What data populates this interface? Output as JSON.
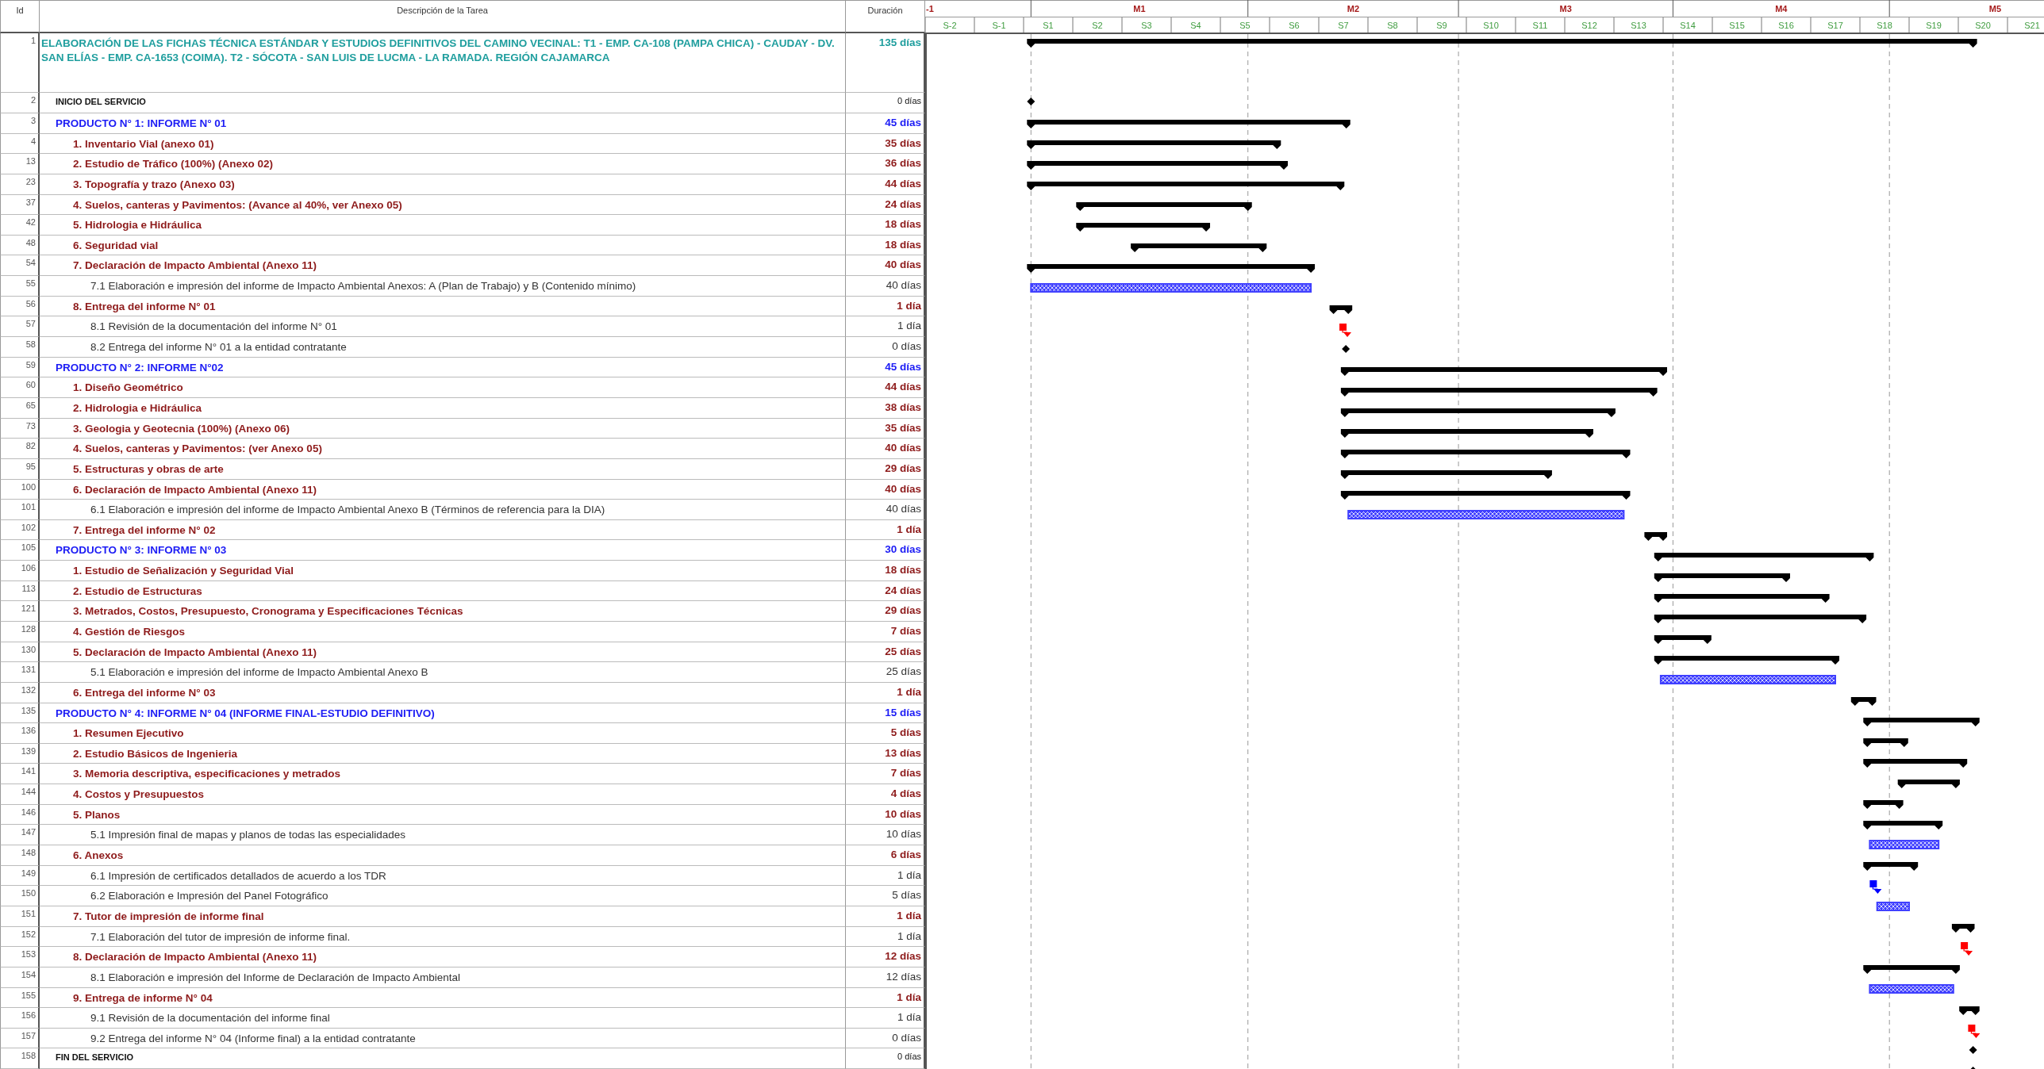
{
  "table": {
    "columns": [
      "Id",
      "Descripción de la Tarea",
      "Duración"
    ],
    "rows": [
      {
        "id": "1",
        "kind": "project",
        "name": "ELABORACIÓN DE LAS FICHAS TÉCNICA ESTÁNDAR Y ESTUDIOS DEFINITIVOS DEL CAMINO VECINAL: T1 - EMP. CA-108 (PAMPA CHICA) - CAUDAY - DV. SAN ELÍAS - EMP. CA-1653 (COIMA). T2 - SÓCOTA - SAN LUIS DE LUCMA - LA RAMADA. REGIÓN CAJAMARCA",
        "duration": "135 días",
        "children": [
          {
            "id": "2",
            "kind": "event",
            "name": "INICIO DEL SERVICIO",
            "duration": "0 días"
          },
          {
            "id": "3",
            "kind": "product",
            "name": "PRODUCTO N° 1: INFORME N° 01",
            "duration": "45 días",
            "children": [
              {
                "id": "4",
                "kind": "task",
                "name": "1. Inventario Vial (anexo 01)",
                "duration": "35 días"
              },
              {
                "id": "13",
                "kind": "task",
                "name": "2. Estudio de Tráfico (100%) (Anexo 02)",
                "duration": "36 días"
              },
              {
                "id": "23",
                "kind": "task",
                "name": "3. Topografía y trazo (Anexo 03)",
                "duration": "44 días"
              },
              {
                "id": "37",
                "kind": "task",
                "name": "4. Suelos, canteras y Pavimentos: (Avance al 40%, ver Anexo 05)",
                "duration": "24 días"
              },
              {
                "id": "42",
                "kind": "task",
                "name": "5. Hidrologia e Hidráulica",
                "duration": "18 días"
              },
              {
                "id": "48",
                "kind": "task",
                "name": "6. Seguridad vial",
                "duration": "18 días"
              },
              {
                "id": "54",
                "kind": "task",
                "name": "7. Declaración de Impacto Ambiental (Anexo 11)",
                "duration": "40 días",
                "children": [
                  {
                    "id": "55",
                    "kind": "subtask",
                    "name": "7.1 Elaboración e impresión del informe de Impacto Ambiental Anexos: A (Plan de Trabajo)  y B (Contenido mínimo)",
                    "duration": "40 días",
                    "color": "#4040ff"
                  }
                ]
              },
              {
                "id": "56",
                "kind": "task",
                "name": "8. Entrega del informe N° 01",
                "duration": "1 día",
                "children": [
                  {
                    "id": "57",
                    "kind": "subtask",
                    "name": "8.1 Revisión de la documentación del informe N° 01",
                    "duration": "1 día",
                    "color": "#ff0000"
                  },
                  {
                    "id": "58",
                    "kind": "milestone",
                    "name": "8.2 Entrega del informe N° 01 a la entidad contratante",
                    "duration": "0 días"
                  }
                ]
              }
            ]
          },
          {
            "id": "59",
            "kind": "product",
            "name": "PRODUCTO N° 2: INFORME N°02",
            "duration": "45 días",
            "children": [
              {
                "id": "60",
                "kind": "task",
                "name": "1. Diseño Geométrico",
                "duration": "44 días"
              },
              {
                "id": "65",
                "kind": "task",
                "name": "2. Hidrologia e Hidráulica",
                "duration": "38 días"
              },
              {
                "id": "73",
                "kind": "task",
                "name": "3. Geologia y Geotecnia (100%) (Anexo 06)",
                "duration": "35 días"
              },
              {
                "id": "82",
                "kind": "task",
                "name": "4. Suelos, canteras y Pavimentos: (ver Anexo 05)",
                "duration": "40 días"
              },
              {
                "id": "95",
                "kind": "task",
                "name": "5. Estructuras y obras de arte",
                "duration": "29 días"
              },
              {
                "id": "100",
                "kind": "task",
                "name": "6. Declaración de Impacto Ambiental (Anexo 11)",
                "duration": "40 días",
                "children": [
                  {
                    "id": "101",
                    "kind": "subtask",
                    "name": "6.1 Elaboración e impresión del informe de Impacto Ambiental Anexo B (Términos de referencia para la DIA)",
                    "duration": "40 días",
                    "color": "#4040ff"
                  }
                ]
              },
              {
                "id": "102",
                "kind": "task",
                "name": "7. Entrega del informe N° 02",
                "duration": "1 día"
              }
            ]
          },
          {
            "id": "105",
            "kind": "product",
            "name": "PRODUCTO N° 3: INFORME N° 03",
            "duration": "30 días",
            "children": [
              {
                "id": "106",
                "kind": "task",
                "name": "1. Estudio de Señalización y Seguridad Vial",
                "duration": "18 días"
              },
              {
                "id": "113",
                "kind": "task",
                "name": "2. Estudio de Estructuras",
                "duration": "24 días"
              },
              {
                "id": "121",
                "kind": "task",
                "name": "3. Metrados, Costos, Presupuesto, Cronograma y Especificaciones Técnicas",
                "duration": "29 días"
              },
              {
                "id": "128",
                "kind": "task",
                "name": "4. Gestión de Riesgos",
                "duration": "7 días"
              },
              {
                "id": "130",
                "kind": "task",
                "name": "5. Declaración de Impacto Ambiental (Anexo 11)",
                "duration": "25 días",
                "children": [
                  {
                    "id": "131",
                    "kind": "subtask",
                    "name": "5.1 Elaboración e impresión del informe de Impacto Ambiental Anexo B",
                    "duration": "25 días",
                    "color": "#4040ff"
                  }
                ]
              },
              {
                "id": "132",
                "kind": "task",
                "name": "6. Entrega del informe N° 03",
                "duration": "1 día"
              }
            ]
          },
          {
            "id": "135",
            "kind": "product",
            "name": "PRODUCTO N° 4: INFORME N° 04 (INFORME FINAL-ESTUDIO DEFINITIVO)",
            "duration": "15 días",
            "children": [
              {
                "id": "136",
                "kind": "task",
                "name": "1. Resumen Ejecutivo",
                "duration": "5 días"
              },
              {
                "id": "139",
                "kind": "task",
                "name": "2. Estudio Básicos de Ingenieria",
                "duration": "13 días"
              },
              {
                "id": "141",
                "kind": "task",
                "name": "3. Memoria descriptiva, especificaciones y metrados",
                "duration": "7 días"
              },
              {
                "id": "144",
                "kind": "task",
                "name": "4. Costos y Presupuestos",
                "duration": "4 días"
              },
              {
                "id": "146",
                "kind": "task",
                "name": "5. Planos",
                "duration": "10 días",
                "children": [
                  {
                    "id": "147",
                    "kind": "subtask",
                    "name": "5.1 Impresión final de mapas y planos de todas las especialidades",
                    "duration": "10 días",
                    "color": "#4040ff"
                  }
                ]
              },
              {
                "id": "148",
                "kind": "task",
                "name": "6. Anexos",
                "duration": "6 días",
                "children": [
                  {
                    "id": "149",
                    "kind": "subtask",
                    "name": "6.1 Impresión de certificados detallados de acuerdo a los TDR",
                    "duration": "1 día",
                    "color": "#0000ff"
                  },
                  {
                    "id": "150",
                    "kind": "subtask",
                    "name": "6.2 Elaboración e Impresión del Panel Fotográfico",
                    "duration": "5 días",
                    "color": "#4040ff"
                  }
                ]
              },
              {
                "id": "151",
                "kind": "task",
                "name": "7. Tutor de impresión de informe final",
                "duration": "1 día",
                "children": [
                  {
                    "id": "152",
                    "kind": "subtask",
                    "name": "7.1 Elaboración del tutor de impresión de informe final.",
                    "duration": "1 día",
                    "color": "#ff0000"
                  }
                ]
              },
              {
                "id": "153",
                "kind": "task",
                "name": "8. Declaración de Impacto Ambiental (Anexo 11)",
                "duration": "12 días",
                "children": [
                  {
                    "id": "154",
                    "kind": "subtask",
                    "name": "8.1 Elaboración e impresión del Informe de Declaración de Impacto Ambiental",
                    "duration": "12 días",
                    "color": "#4040ff"
                  }
                ]
              },
              {
                "id": "155",
                "kind": "task",
                "name": "9. Entrega de informe N° 04",
                "duration": "1 día",
                "children": [
                  {
                    "id": "156",
                    "kind": "subtask",
                    "name": "9.1 Revisión de la documentación del informe final",
                    "duration": "1 día",
                    "color": "#ff0000"
                  },
                  {
                    "id": "157",
                    "kind": "milestone",
                    "name": "9.2 Entrega del informe N° 04 (Informe final) a la entidad contratante",
                    "duration": "0 días"
                  }
                ]
              }
            ]
          },
          {
            "id": "158",
            "kind": "event",
            "name": "FIN DEL SERVICIO",
            "duration": "0 días"
          }
        ]
      }
    ]
  },
  "gantt": {
    "months": [
      "-1",
      "M1",
      "M2",
      "M3",
      "M4",
      "M5"
    ],
    "weeks": [
      "S-2",
      "S-1",
      "S1",
      "S2",
      "S3",
      "S4",
      "S5",
      "S6",
      "S7",
      "S8",
      "S9",
      "S10",
      "S11",
      "S12",
      "S13",
      "S14",
      "S15",
      "S16",
      "S17",
      "S18",
      "S19",
      "S20",
      "S21"
    ]
  }
}
